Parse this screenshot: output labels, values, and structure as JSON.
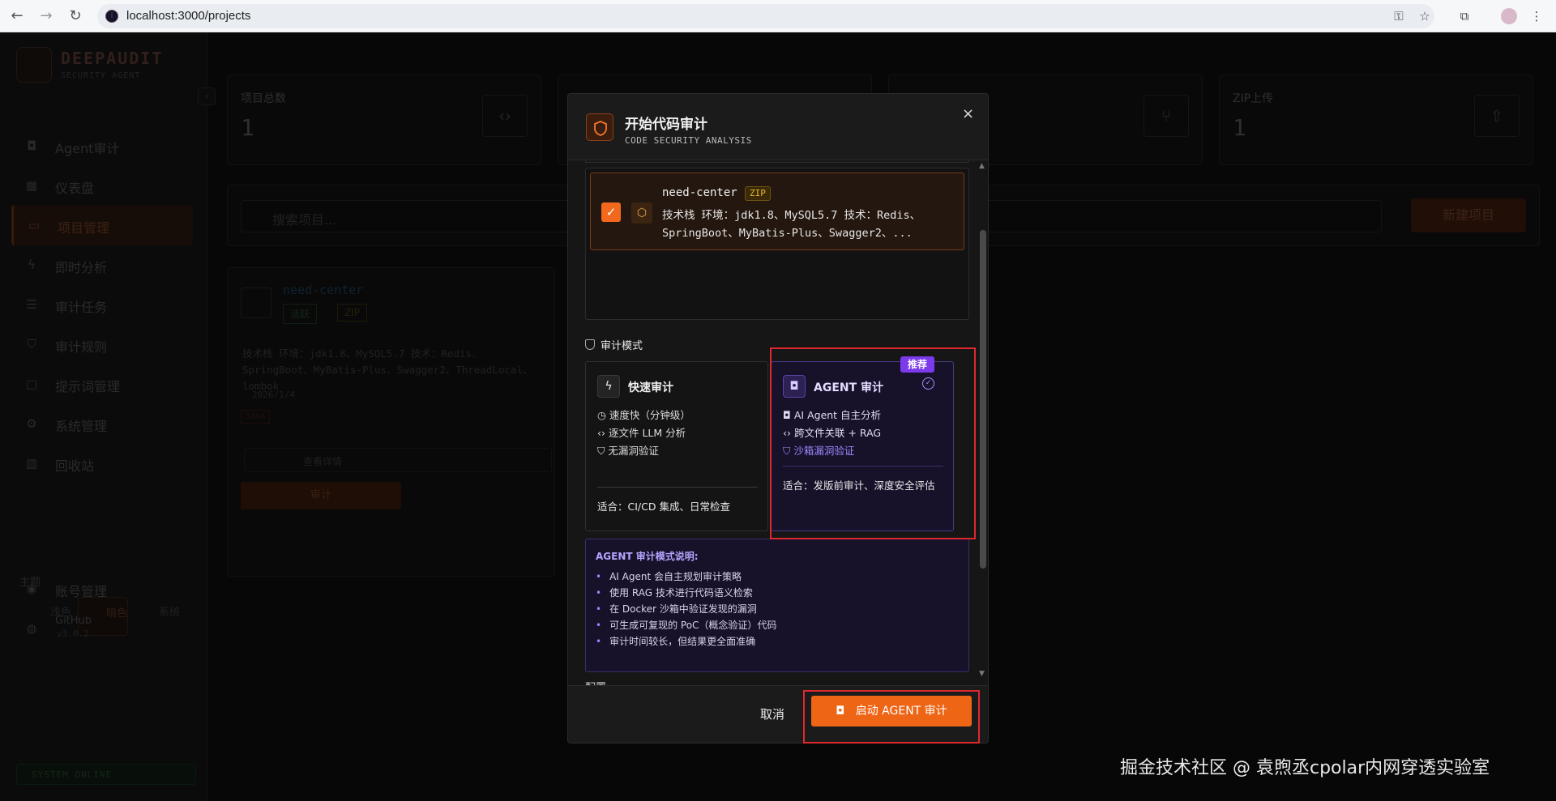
{
  "browser": {
    "url": "localhost:3000/projects"
  },
  "sidebar": {
    "logo_title": "DEEPAUDIT",
    "logo_subtitle": "SECURITY AGENT",
    "items": [
      {
        "label": "Agent审计",
        "icon": "robot-icon"
      },
      {
        "label": "仪表盘",
        "icon": "dashboard-icon"
      },
      {
        "label": "项目管理",
        "icon": "folder-icon",
        "active": true
      },
      {
        "label": "即时分析",
        "icon": "bolt-icon"
      },
      {
        "label": "审计任务",
        "icon": "list-icon"
      },
      {
        "label": "审计规则",
        "icon": "shield-icon"
      },
      {
        "label": "提示词管理",
        "icon": "chat-icon"
      },
      {
        "label": "系统管理",
        "icon": "gear-icon"
      },
      {
        "label": "回收站",
        "icon": "trash-icon"
      }
    ],
    "theme_label": "主题",
    "themes": [
      "浅色",
      "暗色",
      "系统"
    ],
    "account": "账号管理",
    "github": "GitHub",
    "version": "v3.0.2",
    "status": "SYSTEM ONLINE"
  },
  "stats": [
    {
      "label": "项目总数",
      "value": "1"
    },
    {
      "label": "",
      "value": ""
    },
    {
      "label": "",
      "value": ""
    },
    {
      "label": "ZIP上传",
      "value": "1"
    }
  ],
  "search": {
    "placeholder": "搜索项目...",
    "new_button": "新建项目"
  },
  "bg_project": {
    "name": "need-center",
    "status": "活跃",
    "type": "ZIP",
    "desc": "技术栈 环境：jdk1.8、MySQL5.7 技术：Redis、SpringBoot、MyBatis-Plus、Swagger2、ThreadLocal、lombok",
    "date": "2026/1/4",
    "lang": "JAVA",
    "view_details": "查看详情",
    "audit_button": "审计"
  },
  "modal": {
    "title": "开始代码审计",
    "subtitle": "CODE SECURITY ANALYSIS",
    "close": "×",
    "project": {
      "name": "need-center",
      "tag": "ZIP",
      "desc": "技术栈 环境：jdk1.8、MySQL5.7 技术：Redis、SpringBoot、MyBatis-Plus、Swagger2、..."
    },
    "mode_heading": "审计模式",
    "fast": {
      "title": "快速审计",
      "features": [
        "速度快（分钟级）",
        "逐文件 LLM 分析",
        "无漏洞验证"
      ],
      "suitable": "适合：CI/CD 集成、日常检查"
    },
    "agent": {
      "title": "AGENT 审计",
      "badge": "推荐",
      "features": [
        "AI Agent 自主分析",
        "跨文件关联 + RAG",
        "沙箱漏洞验证"
      ],
      "suitable": "适合：发版前审计、深度安全评估"
    },
    "info": {
      "heading": "AGENT 审计模式说明:",
      "items": [
        "AI Agent 会自主规划审计策略",
        "使用 RAG 技术进行代码语义检索",
        "在 Docker 沙箱中验证发现的漏洞",
        "可生成可复现的 PoC（概念验证）代码",
        "审计时间较长，但结果更全面准确"
      ]
    },
    "config_heading": "配置",
    "cancel": "取消",
    "start": "启动 AGENT 审计"
  },
  "watermark": "掘金技术社区 @ 袁煦丞cpolar内网穿透实验室"
}
